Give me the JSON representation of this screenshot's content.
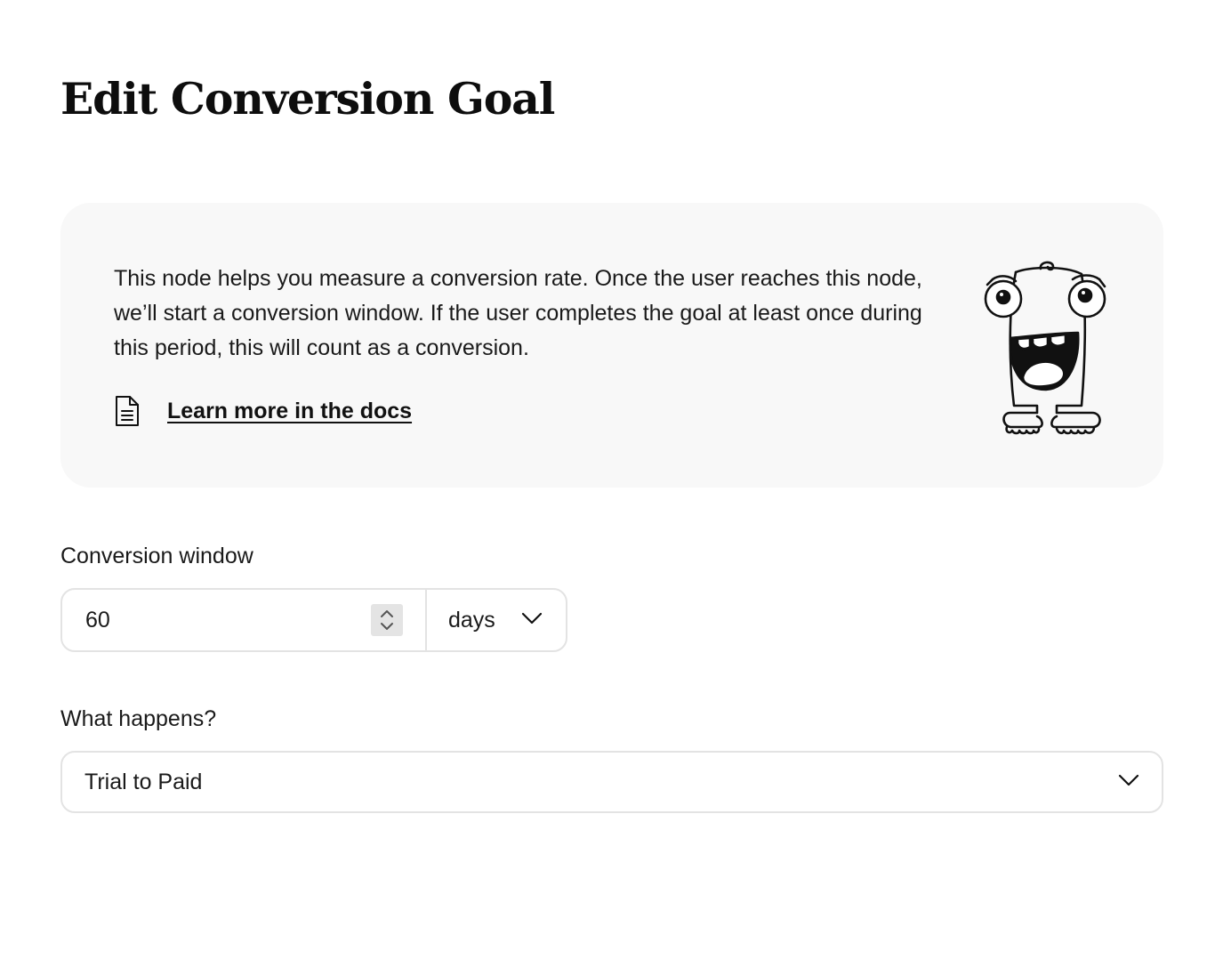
{
  "page": {
    "title": "Edit Conversion Goal"
  },
  "info": {
    "description": "This node helps you measure a conversion rate. Once the user reaches this node, we’ll start a conversion window. If the user completes the goal at least once during this period, this will count as a conversion.",
    "docs_link_label": "Learn more in the docs",
    "doc_icon": "document-icon",
    "illustration": "monster-mascot-illustration"
  },
  "conversion_window": {
    "label": "Conversion window",
    "value": "60",
    "unit": "days",
    "stepper_icon": "stepper-arrows-icon",
    "dropdown_icon": "chevron-down-icon"
  },
  "what_happens": {
    "label": "What happens?",
    "selected": "Trial to Paid",
    "dropdown_icon": "chevron-down-icon"
  }
}
